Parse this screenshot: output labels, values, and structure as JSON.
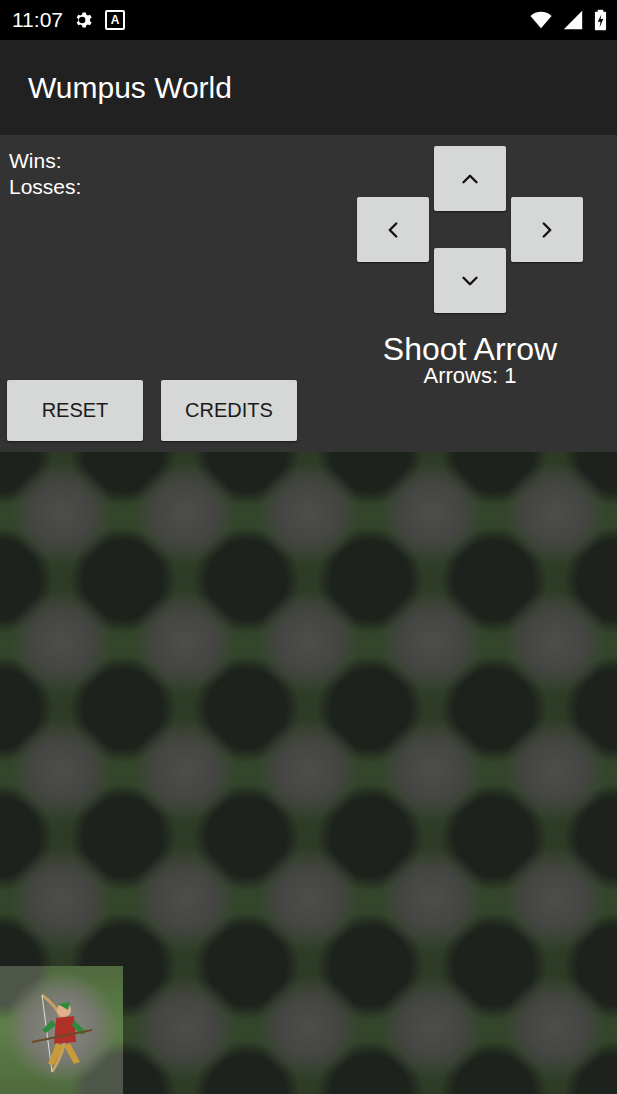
{
  "status_bar": {
    "time": "11:07",
    "notification": "A"
  },
  "window": {
    "title": "Wumpus World"
  },
  "stats": {
    "wins": "Wins:",
    "losses": "Losses:"
  },
  "dpad": [
    {
      "direction": "up"
    },
    {
      "direction": "left"
    },
    {
      "direction": "right"
    },
    {
      "direction": "down"
    }
  ],
  "shoot": {
    "label": "Shoot Arrow",
    "arrows": "Arrows: 1"
  },
  "buttons": [
    "RESET",
    "CREDITS"
  ],
  "grid": {
    "rows": [
      [
        {
          "player": false
        },
        {
          "player": false
        },
        {
          "player": false
        },
        {
          "player": false
        },
        {
          "player": false
        }
      ],
      [
        {
          "player": false
        },
        {
          "player": false
        },
        {
          "player": false
        },
        {
          "player": false
        },
        {
          "player": false
        }
      ],
      [
        {
          "player": false
        },
        {
          "player": false
        },
        {
          "player": false
        },
        {
          "player": false
        },
        {
          "player": false
        }
      ],
      [
        {
          "player": false
        },
        {
          "player": false
        },
        {
          "player": false
        },
        {
          "player": false
        },
        {
          "player": false
        }
      ],
      [
        {
          "player": true
        },
        {
          "player": false
        },
        {
          "player": false
        },
        {
          "player": false
        },
        {
          "player": false
        }
      ]
    ]
  }
}
